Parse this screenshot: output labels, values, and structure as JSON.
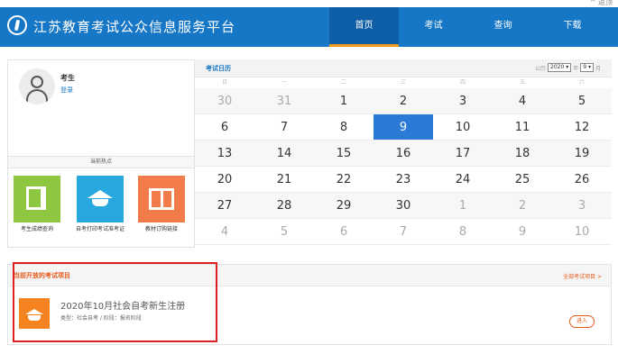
{
  "header": {
    "title": "江苏教育考试公众信息服务平台",
    "top_right": "^ 返顶",
    "nav": [
      {
        "label": "首页",
        "active": true
      },
      {
        "label": "考试",
        "active": false
      },
      {
        "label": "查询",
        "active": false
      },
      {
        "label": "下载",
        "active": false
      }
    ]
  },
  "user": {
    "name": "考生",
    "login": "登录"
  },
  "hot": {
    "title": "当前热点",
    "items": [
      {
        "label": "考生成绩查询",
        "icon": "book-icon",
        "color": "#8dc63f"
      },
      {
        "label": "自考打印考试准考证",
        "icon": "graduation-cap-icon",
        "color": "#29a8e0"
      },
      {
        "label": "教材订购链接",
        "icon": "open-book-icon",
        "color": "#f27b4a"
      }
    ]
  },
  "calendar": {
    "title": "考试日历",
    "year_label": "公历",
    "year": "2020",
    "year_suffix": "年",
    "month": "9",
    "month_suffix": "月",
    "weekdays": [
      "日",
      "一",
      "二",
      "三",
      "四",
      "五",
      "六"
    ],
    "weeks": [
      [
        "30",
        "31",
        "1",
        "2",
        "3",
        "4",
        "5"
      ],
      [
        "6",
        "7",
        "8",
        "9",
        "10",
        "11",
        "12"
      ],
      [
        "13",
        "14",
        "15",
        "16",
        "17",
        "18",
        "19"
      ],
      [
        "20",
        "21",
        "22",
        "23",
        "24",
        "25",
        "26"
      ],
      [
        "27",
        "28",
        "29",
        "30",
        "1",
        "2",
        "3"
      ],
      [
        "4",
        "5",
        "6",
        "7",
        "8",
        "9",
        "10"
      ]
    ],
    "today": "9",
    "highlight_color": "#2b7ad6"
  },
  "projects": {
    "title": "当前开放的考试项目",
    "all_link": "全部考试项目 >",
    "items": [
      {
        "name": "2020年10月社会自考新生注册",
        "meta": "类型：社会自考 / 阶段：报名阶段",
        "button": "进入",
        "icon": "graduation-cap-icon"
      }
    ]
  },
  "colors": {
    "header": "#1677c6",
    "accent": "#e55a1c",
    "annotation_box": "#e02020"
  }
}
